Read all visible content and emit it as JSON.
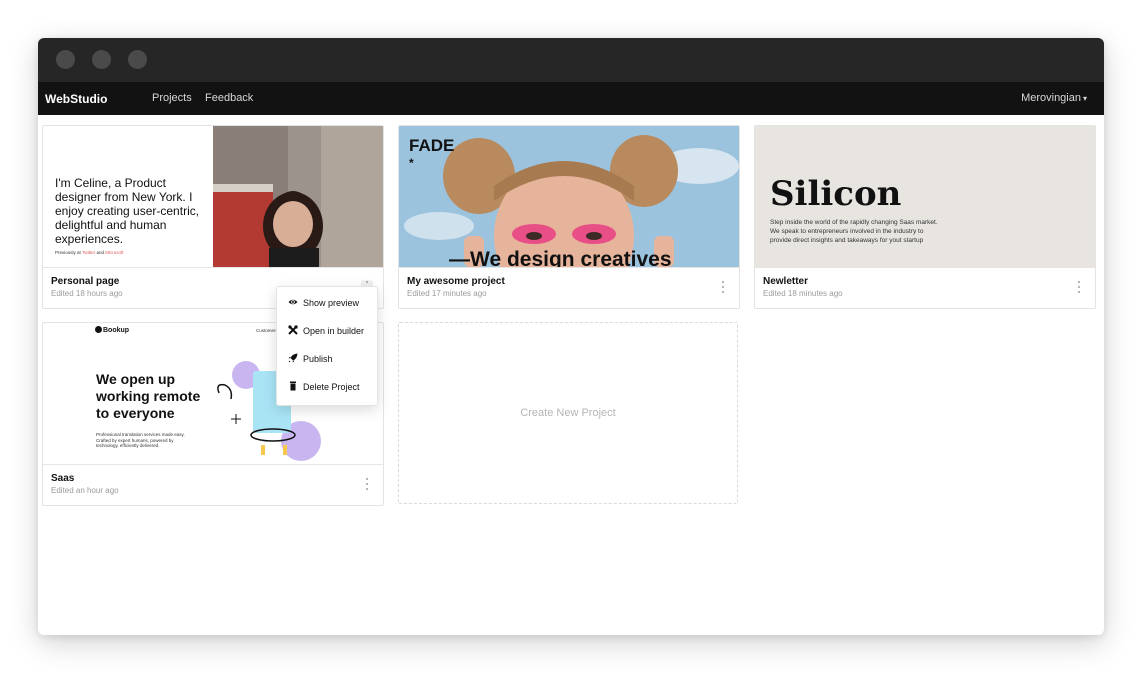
{
  "app": {
    "brand": "WebStudio"
  },
  "nav": {
    "projects": "Projects",
    "feedback": "Feedback",
    "user": "Merovingian"
  },
  "projects": [
    {
      "title": "Personal page",
      "edited": "Edited 18 hours ago",
      "preview": {
        "headline": "I'm Celine, a Product designer from New York. I enjoy creating user-centric, delightful and human experiences.",
        "previously": "Previously at",
        "twitter": "Twitter",
        "and": "and",
        "microsoft": "Microsoft"
      }
    },
    {
      "title": "My awesome project",
      "edited": "Edited 17 minutes ago",
      "preview": {
        "logo": "FADE",
        "star": "*",
        "tagline": "—We design creatives"
      }
    },
    {
      "title": "Newletter",
      "edited": "Edited 18 minutes ago",
      "preview": {
        "headline": "Silicon",
        "body": "Step inside the world of the rapidly changing Saas market. We speak to entrepreneurs involved in the industry to provide direct insights and takeaways for yout startup"
      }
    },
    {
      "title": "Saas",
      "edited": "Edited an hour ago",
      "preview": {
        "brand": "Bookup",
        "nav": "Customers",
        "headline": "We open up working remote to everyone",
        "body": "Professional translation services made easy. Crafted by expert humans, powered by technology, efficiently delivered."
      }
    }
  ],
  "create_new": "Create New Project",
  "context_menu": {
    "items": [
      {
        "label": "Show preview",
        "icon": "eye-icon"
      },
      {
        "label": "Open in builder",
        "icon": "tools-icon"
      },
      {
        "label": "Publish",
        "icon": "rocket-icon"
      },
      {
        "label": "Delete Project",
        "icon": "trash-icon"
      }
    ]
  },
  "colors": {
    "titlebar": "#262626",
    "navbar": "#121212",
    "accent_link": "#e05a5a",
    "lavender": "#c9b6f0"
  }
}
